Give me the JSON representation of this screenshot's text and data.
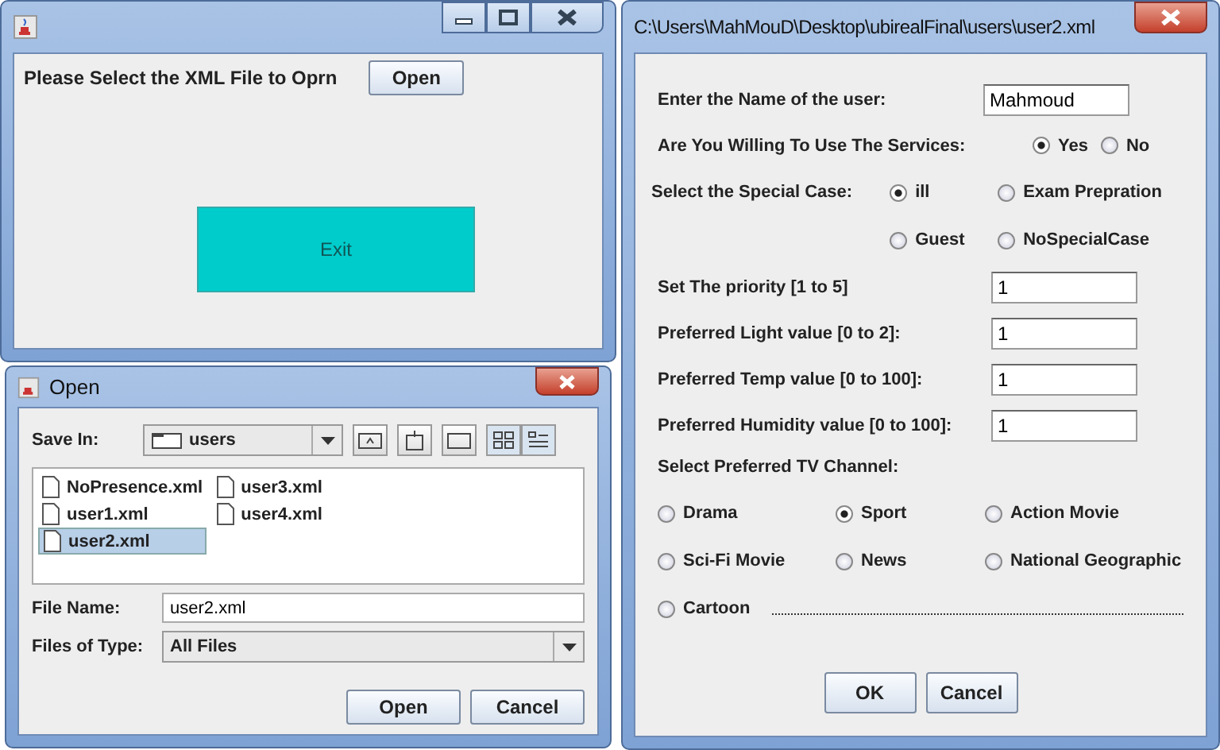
{
  "main_window": {
    "prompt": "Please Select the XML File to Oprn",
    "open_button": "Open",
    "exit_button": "Exit"
  },
  "open_dialog": {
    "title": "Open",
    "save_in_label": "Save In:",
    "save_in_value": "users",
    "files": [
      {
        "name": "NoPresence.xml",
        "selected": false
      },
      {
        "name": "user1.xml",
        "selected": false
      },
      {
        "name": "user2.xml",
        "selected": true
      },
      {
        "name": "user3.xml",
        "selected": false
      },
      {
        "name": "user4.xml",
        "selected": false
      }
    ],
    "file_name_label": "File Name:",
    "file_name_value": "user2.xml",
    "file_type_label": "Files of Type:",
    "file_type_value": "All Files",
    "buttons": [
      "Open",
      "Cancel"
    ]
  },
  "user_window": {
    "title": "C:\\Users\\MahMouD\\Desktop\\ubirealFinal\\users\\user2.xml",
    "name_label": "Enter the Name of the user:",
    "name_value": "Mahmoud",
    "services": {
      "label": "Are You Willing To Use The Services:",
      "options": [
        {
          "label": "Yes",
          "selected": true
        },
        {
          "label": "No",
          "selected": false
        }
      ]
    },
    "special_case": {
      "label": "Select the Special Case:",
      "options": [
        {
          "label": "ill",
          "selected": true
        },
        {
          "label": "Exam Prepration",
          "selected": false
        },
        {
          "label": "Guest",
          "selected": false
        },
        {
          "label": "NoSpecialCase",
          "selected": false
        }
      ]
    },
    "fields": [
      {
        "label": "Set The priority [1 to 5]",
        "value": "1"
      },
      {
        "label": "Preferred Light value [0 to 2]:",
        "value": "1"
      },
      {
        "label": "Preferred Temp value [0 to 100]:",
        "value": "1"
      },
      {
        "label": "Preferred Humidity value [0 to 100]:",
        "value": "1"
      }
    ],
    "tv": {
      "label": "Select Preferred TV Channel:",
      "options": [
        {
          "label": "Drama",
          "selected": false
        },
        {
          "label": "Sport",
          "selected": true
        },
        {
          "label": "Action Movie",
          "selected": false
        },
        {
          "label": "Sci-Fi Movie",
          "selected": false
        },
        {
          "label": "News",
          "selected": false
        },
        {
          "label": "National Geographic",
          "selected": false
        },
        {
          "label": "Cartoon",
          "selected": false
        }
      ]
    },
    "buttons": [
      "OK",
      "Cancel"
    ]
  }
}
